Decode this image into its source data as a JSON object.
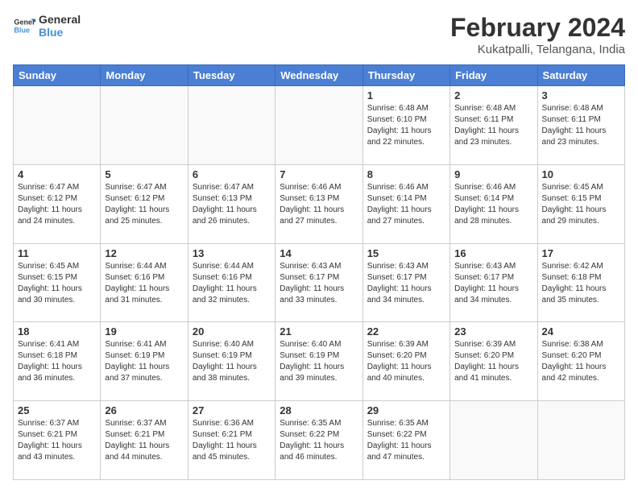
{
  "logo": {
    "line1": "General",
    "line2": "Blue"
  },
  "title": "February 2024",
  "subtitle": "Kukatpalli, Telangana, India",
  "days_of_week": [
    "Sunday",
    "Monday",
    "Tuesday",
    "Wednesday",
    "Thursday",
    "Friday",
    "Saturday"
  ],
  "weeks": [
    [
      {
        "day": "",
        "info": ""
      },
      {
        "day": "",
        "info": ""
      },
      {
        "day": "",
        "info": ""
      },
      {
        "day": "",
        "info": ""
      },
      {
        "day": "1",
        "info": "Sunrise: 6:48 AM\nSunset: 6:10 PM\nDaylight: 11 hours and 22 minutes."
      },
      {
        "day": "2",
        "info": "Sunrise: 6:48 AM\nSunset: 6:11 PM\nDaylight: 11 hours and 23 minutes."
      },
      {
        "day": "3",
        "info": "Sunrise: 6:48 AM\nSunset: 6:11 PM\nDaylight: 11 hours and 23 minutes."
      }
    ],
    [
      {
        "day": "4",
        "info": "Sunrise: 6:47 AM\nSunset: 6:12 PM\nDaylight: 11 hours and 24 minutes."
      },
      {
        "day": "5",
        "info": "Sunrise: 6:47 AM\nSunset: 6:12 PM\nDaylight: 11 hours and 25 minutes."
      },
      {
        "day": "6",
        "info": "Sunrise: 6:47 AM\nSunset: 6:13 PM\nDaylight: 11 hours and 26 minutes."
      },
      {
        "day": "7",
        "info": "Sunrise: 6:46 AM\nSunset: 6:13 PM\nDaylight: 11 hours and 27 minutes."
      },
      {
        "day": "8",
        "info": "Sunrise: 6:46 AM\nSunset: 6:14 PM\nDaylight: 11 hours and 27 minutes."
      },
      {
        "day": "9",
        "info": "Sunrise: 6:46 AM\nSunset: 6:14 PM\nDaylight: 11 hours and 28 minutes."
      },
      {
        "day": "10",
        "info": "Sunrise: 6:45 AM\nSunset: 6:15 PM\nDaylight: 11 hours and 29 minutes."
      }
    ],
    [
      {
        "day": "11",
        "info": "Sunrise: 6:45 AM\nSunset: 6:15 PM\nDaylight: 11 hours and 30 minutes."
      },
      {
        "day": "12",
        "info": "Sunrise: 6:44 AM\nSunset: 6:16 PM\nDaylight: 11 hours and 31 minutes."
      },
      {
        "day": "13",
        "info": "Sunrise: 6:44 AM\nSunset: 6:16 PM\nDaylight: 11 hours and 32 minutes."
      },
      {
        "day": "14",
        "info": "Sunrise: 6:43 AM\nSunset: 6:17 PM\nDaylight: 11 hours and 33 minutes."
      },
      {
        "day": "15",
        "info": "Sunrise: 6:43 AM\nSunset: 6:17 PM\nDaylight: 11 hours and 34 minutes."
      },
      {
        "day": "16",
        "info": "Sunrise: 6:43 AM\nSunset: 6:17 PM\nDaylight: 11 hours and 34 minutes."
      },
      {
        "day": "17",
        "info": "Sunrise: 6:42 AM\nSunset: 6:18 PM\nDaylight: 11 hours and 35 minutes."
      }
    ],
    [
      {
        "day": "18",
        "info": "Sunrise: 6:41 AM\nSunset: 6:18 PM\nDaylight: 11 hours and 36 minutes."
      },
      {
        "day": "19",
        "info": "Sunrise: 6:41 AM\nSunset: 6:19 PM\nDaylight: 11 hours and 37 minutes."
      },
      {
        "day": "20",
        "info": "Sunrise: 6:40 AM\nSunset: 6:19 PM\nDaylight: 11 hours and 38 minutes."
      },
      {
        "day": "21",
        "info": "Sunrise: 6:40 AM\nSunset: 6:19 PM\nDaylight: 11 hours and 39 minutes."
      },
      {
        "day": "22",
        "info": "Sunrise: 6:39 AM\nSunset: 6:20 PM\nDaylight: 11 hours and 40 minutes."
      },
      {
        "day": "23",
        "info": "Sunrise: 6:39 AM\nSunset: 6:20 PM\nDaylight: 11 hours and 41 minutes."
      },
      {
        "day": "24",
        "info": "Sunrise: 6:38 AM\nSunset: 6:20 PM\nDaylight: 11 hours and 42 minutes."
      }
    ],
    [
      {
        "day": "25",
        "info": "Sunrise: 6:37 AM\nSunset: 6:21 PM\nDaylight: 11 hours and 43 minutes."
      },
      {
        "day": "26",
        "info": "Sunrise: 6:37 AM\nSunset: 6:21 PM\nDaylight: 11 hours and 44 minutes."
      },
      {
        "day": "27",
        "info": "Sunrise: 6:36 AM\nSunset: 6:21 PM\nDaylight: 11 hours and 45 minutes."
      },
      {
        "day": "28",
        "info": "Sunrise: 6:35 AM\nSunset: 6:22 PM\nDaylight: 11 hours and 46 minutes."
      },
      {
        "day": "29",
        "info": "Sunrise: 6:35 AM\nSunset: 6:22 PM\nDaylight: 11 hours and 47 minutes."
      },
      {
        "day": "",
        "info": ""
      },
      {
        "day": "",
        "info": ""
      }
    ]
  ]
}
